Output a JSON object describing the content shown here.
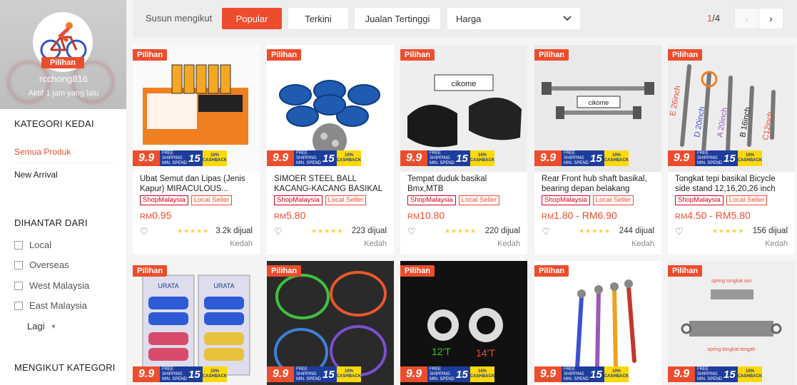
{
  "shop": {
    "name": "rcchong816",
    "status": "Aktif 1 jam yang lalu",
    "badge": "Pilihan"
  },
  "sidebar": {
    "category_title": "KATEGORI KEDAI",
    "links": [
      {
        "label": "Semua Produk",
        "active": true
      },
      {
        "label": "New Arrival",
        "active": false
      }
    ],
    "shipped_from_title": "DIHANTAR DARI",
    "locations": [
      "Local",
      "Overseas",
      "West Malaysia",
      "East Malaysia"
    ],
    "more_label": "Lagi",
    "by_category_title": "MENGIKUT KATEGORI"
  },
  "sortbar": {
    "label": "Susun mengikut",
    "buttons": [
      {
        "label": "Popular",
        "active": true
      },
      {
        "label": "Terkini",
        "active": false
      },
      {
        "label": "Jualan Tertinggi",
        "active": false
      }
    ],
    "price_select": "Harga",
    "page_current": "1",
    "page_total": "/4"
  },
  "promo": {
    "sale": "9.9",
    "free_shipping_line1": "FREE",
    "free_shipping_line2": "SHIPPING",
    "free_shipping_line3": "MIN. SPEND",
    "free_shipping_amount": "15",
    "cashback_pct": "10%",
    "cashback_label": "CASHBACK"
  },
  "products": [
    {
      "badge": "Pilihan",
      "title": "Ubat Semut dan Lipas (Jenis Kapur) MIRACULOUS...",
      "tags": [
        "ShopMalaysia",
        "Local Seller"
      ],
      "price_currency": "RM",
      "price": "0.95",
      "rating": 5,
      "stars": "★★★★★",
      "sold": "3.2k dijual",
      "location": "Kedah",
      "image_kind": "chalk-box"
    },
    {
      "badge": "Pilihan",
      "title": "SIMOER STEEL BALL KACANG-KACANG BASIKAL",
      "tags": [
        "ShopMalaysia",
        "Local Seller"
      ],
      "price_currency": "RM",
      "price": "5.80",
      "rating": 5,
      "stars": "★★★★★",
      "sold": "223 dijual",
      "location": "Kedah",
      "image_kind": "steel-balls"
    },
    {
      "badge": "Pilihan",
      "title": "Tempat duduk basikal Bmx,MTB",
      "tags": [
        "ShopMalaysia",
        "Local Seller"
      ],
      "price_currency": "RM",
      "price": "10.80",
      "rating": 5,
      "stars": "★★★★★",
      "sold": "220 dijual",
      "location": "Kedah",
      "image_kind": "bike-seat",
      "image_text": "cikome"
    },
    {
      "badge": "Pilihan",
      "title": "Rear Front hub shaft basikal, bearing depan belakang",
      "tags": [
        "ShopMalaysia",
        "Local Seller"
      ],
      "price_currency": "RM",
      "price": "1.80 - RM6.90",
      "rating": 5,
      "stars": "★★★★★",
      "sold": "244 dijual",
      "location": "Kedah",
      "image_kind": "hub-shaft",
      "image_text": "cikome"
    },
    {
      "badge": "Pilihan",
      "title": "Tongkat tepi basikal Bicycle side stand 12,16,20,26 inch",
      "tags": [
        "ShopMalaysia",
        "Local Seller"
      ],
      "price_currency": "RM",
      "price": "4.50 - RM5.80",
      "rating": 5,
      "stars": "★★★★★",
      "sold": "156 dijual",
      "location": "Kedah",
      "image_kind": "side-stand",
      "image_labels": [
        "E 26inch",
        "D 20inch",
        "A 20inch",
        "B 16inch",
        "C12inch"
      ]
    },
    {
      "badge": "Pilihan",
      "title": "",
      "tags": [],
      "image_kind": "pedals",
      "image_text": "URATA"
    },
    {
      "badge": "Pilihan",
      "title": "",
      "tags": [],
      "image_kind": "bungee"
    },
    {
      "badge": "Pilihan",
      "title": "",
      "tags": [],
      "image_kind": "cogs",
      "image_labels": [
        "12'T",
        "14'T"
      ]
    },
    {
      "badge": "Pilihan",
      "title": "",
      "tags": [],
      "image_kind": "stands"
    },
    {
      "badge": "Pilihan",
      "title": "",
      "tags": [],
      "image_kind": "springs",
      "image_labels": [
        "spring tongkat sisi",
        "spring tongkat tengah"
      ]
    }
  ],
  "colors": {
    "accent": "#ee4d2d",
    "star": "#ffce3d",
    "promo_blue": "#1d3c9e",
    "promo_yellow": "#ffd900"
  }
}
